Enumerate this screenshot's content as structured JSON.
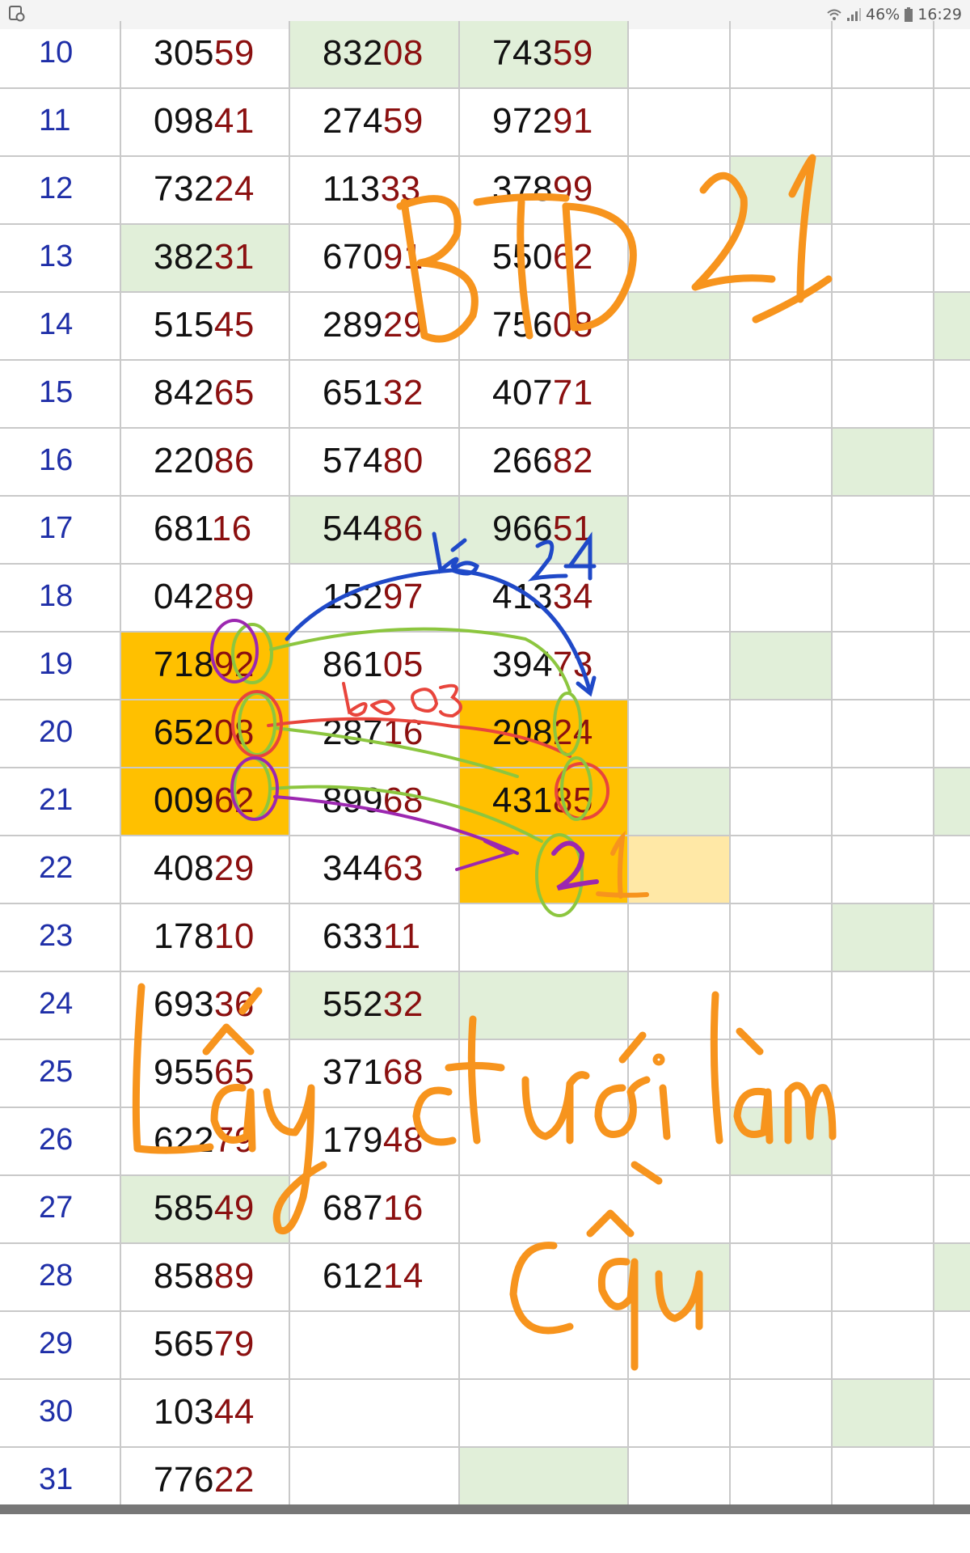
{
  "status_bar": {
    "battery": "46%",
    "time": "16:29"
  },
  "colors": {
    "green": "#e1efd9",
    "orange": "#ffc000",
    "light_orange": "#ffe8a6",
    "day_blue": "#1f2fa8",
    "tail_red": "#8b1010",
    "ink_orange": "#f7941d"
  },
  "rows": [
    {
      "day": "10",
      "v": [
        "30559",
        "83208",
        "74359"
      ],
      "fill": [
        "",
        "g",
        "g",
        "",
        "",
        "",
        ""
      ]
    },
    {
      "day": "11",
      "v": [
        "09841",
        "27459",
        "97291"
      ],
      "fill": [
        "",
        "",
        "",
        "",
        "",
        "",
        ""
      ]
    },
    {
      "day": "12",
      "v": [
        "73224",
        "11333",
        "37899"
      ],
      "fill": [
        "",
        "",
        "",
        "",
        "g",
        "",
        ""
      ]
    },
    {
      "day": "13",
      "v": [
        "38231",
        "67091",
        "55062"
      ],
      "fill": [
        "g",
        "",
        "",
        "",
        "",
        "",
        ""
      ]
    },
    {
      "day": "14",
      "v": [
        "51545",
        "28929",
        "75608"
      ],
      "fill": [
        "",
        "",
        "",
        "g",
        "",
        "",
        "g"
      ]
    },
    {
      "day": "15",
      "v": [
        "84265",
        "65132",
        "40771"
      ],
      "fill": [
        "",
        "",
        "",
        "",
        "",
        "",
        ""
      ]
    },
    {
      "day": "16",
      "v": [
        "22086",
        "57480",
        "26682"
      ],
      "fill": [
        "",
        "",
        "",
        "",
        "",
        "g",
        ""
      ]
    },
    {
      "day": "17",
      "v": [
        "68116",
        "54486",
        "96651"
      ],
      "fill": [
        "",
        "g",
        "g",
        "",
        "",
        "",
        ""
      ]
    },
    {
      "day": "18",
      "v": [
        "04289",
        "15297",
        "41334"
      ],
      "fill": [
        "",
        "",
        "",
        "",
        "",
        "",
        ""
      ]
    },
    {
      "day": "19",
      "v": [
        "71892",
        "86105",
        "39473"
      ],
      "fill": [
        "o",
        "",
        "",
        "",
        "g",
        "",
        ""
      ]
    },
    {
      "day": "20",
      "v": [
        "65208",
        "28716",
        "20824"
      ],
      "fill": [
        "o",
        "",
        "o",
        "",
        "",
        "",
        ""
      ]
    },
    {
      "day": "21",
      "v": [
        "00962",
        "89968",
        "43185"
      ],
      "fill": [
        "o",
        "",
        "o",
        "g",
        "",
        "",
        "g"
      ]
    },
    {
      "day": "22",
      "v": [
        "40829",
        "34463",
        ""
      ],
      "fill": [
        "",
        "",
        "o",
        "y",
        "",
        "",
        ""
      ]
    },
    {
      "day": "23",
      "v": [
        "17810",
        "63311",
        ""
      ],
      "fill": [
        "",
        "",
        "",
        "",
        "",
        "g",
        ""
      ]
    },
    {
      "day": "24",
      "v": [
        "69336",
        "55232",
        ""
      ],
      "fill": [
        "",
        "g",
        "g",
        "",
        "",
        "",
        ""
      ]
    },
    {
      "day": "25",
      "v": [
        "95565",
        "37168",
        ""
      ],
      "fill": [
        "",
        "",
        "",
        "",
        "",
        "",
        ""
      ]
    },
    {
      "day": "26",
      "v": [
        "62279",
        "17948",
        ""
      ],
      "fill": [
        "",
        "",
        "",
        "",
        "g",
        "",
        ""
      ]
    },
    {
      "day": "27",
      "v": [
        "58549",
        "68716",
        ""
      ],
      "fill": [
        "g",
        "",
        "",
        "",
        "",
        "",
        ""
      ]
    },
    {
      "day": "28",
      "v": [
        "85889",
        "61214",
        ""
      ],
      "fill": [
        "",
        "",
        "",
        "g",
        "",
        "",
        "g"
      ]
    },
    {
      "day": "29",
      "v": [
        "56579",
        "",
        ""
      ],
      "fill": [
        "",
        "",
        "",
        "",
        "",
        "",
        ""
      ]
    },
    {
      "day": "30",
      "v": [
        "10344",
        "",
        ""
      ],
      "fill": [
        "",
        "",
        "",
        "",
        "",
        "g",
        ""
      ]
    },
    {
      "day": "31",
      "v": [
        "77622",
        "",
        ""
      ],
      "fill": [
        "",
        "",
        "g",
        "",
        "",
        "",
        ""
      ]
    }
  ],
  "annotations": {
    "title": "BTD 21",
    "note_blue": "bỏ 24",
    "note_red": "bỏ 03",
    "result": "21",
    "note_line1": "Lấy ct ưới làm",
    "note_line2": "cầu"
  }
}
